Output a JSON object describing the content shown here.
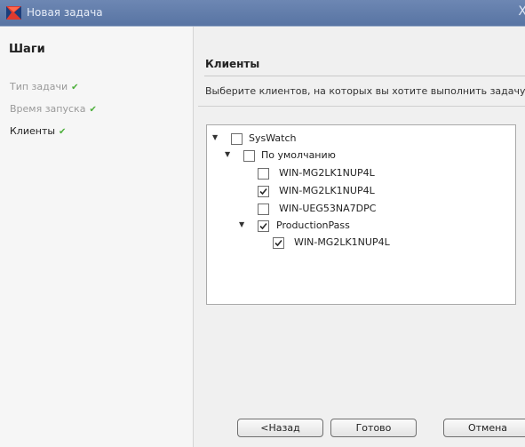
{
  "window": {
    "title": "Новая задача",
    "close_glyph": "X"
  },
  "steps": {
    "title": "Шаги",
    "items": [
      {
        "label": "Тип задачи",
        "state": "done"
      },
      {
        "label": "Время запуска",
        "state": "done"
      },
      {
        "label": "Клиенты",
        "state": "current"
      }
    ]
  },
  "main": {
    "heading": "Клиенты",
    "subtitle": "Выберите клиентов, на которых вы хотите выполнить задачу"
  },
  "tree": [
    {
      "label": "SysWatch",
      "checked": false,
      "expanded": true
    },
    {
      "label": "По умолчанию",
      "checked": false,
      "expanded": true
    },
    {
      "label": "WIN-MG2LK1NUP4L",
      "checked": false
    },
    {
      "label": "WIN-MG2LK1NUP4L",
      "checked": true
    },
    {
      "label": "WIN-UEG53NA7DPC",
      "checked": false
    },
    {
      "label": "ProductionPass",
      "checked": true,
      "expanded": true
    },
    {
      "label": "WIN-MG2LK1NUP4L",
      "checked": true
    }
  ],
  "buttons": {
    "back": "<Назад",
    "done": "Готово",
    "cancel": "Отмена"
  },
  "colors": {
    "titlebar": "#5f7bab",
    "check_accent": "#4caf3a"
  }
}
